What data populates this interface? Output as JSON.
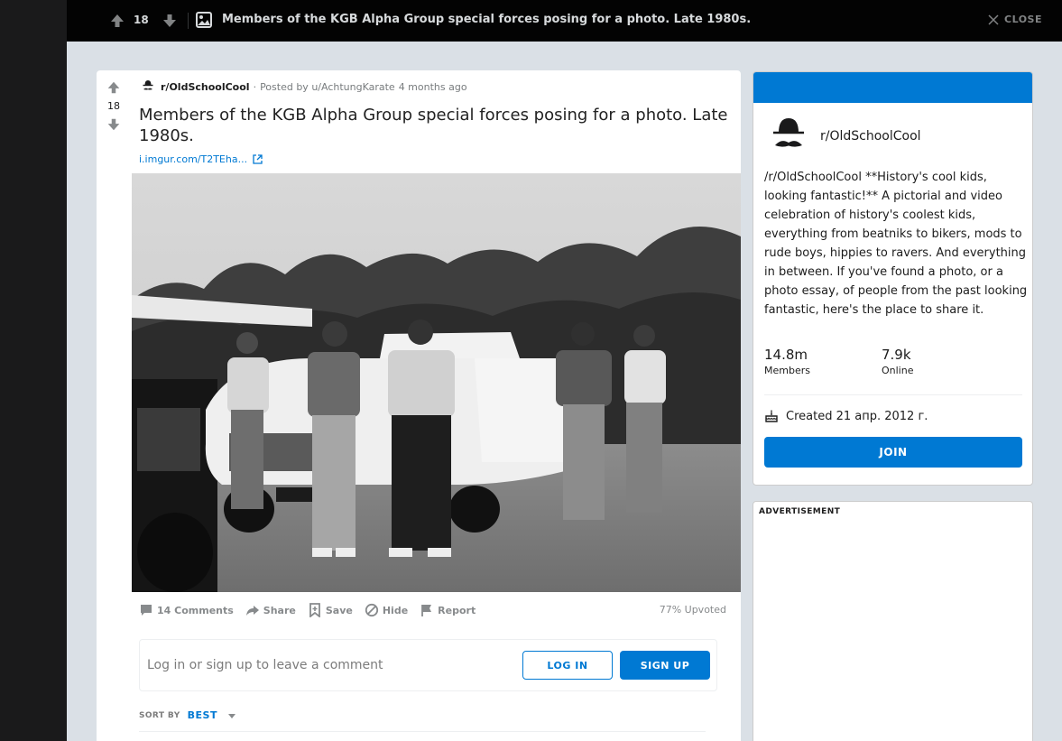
{
  "topbar": {
    "score": "18",
    "title": "Members of the KGB Alpha Group special forces posing for a photo. Late 1980s.",
    "close_label": "CLOSE"
  },
  "post": {
    "score": "18",
    "subreddit": "r/OldSchoolCool",
    "posted_by": "Posted by u/AchtungKarate",
    "time_ago": "4 months ago",
    "title": "Members of the KGB Alpha Group special forces posing for a photo. Late 1980s.",
    "link_text": "i.imgur.com/T2TEha...",
    "actions": {
      "comments": "14 Comments",
      "share": "Share",
      "save": "Save",
      "hide": "Hide",
      "report": "Report"
    },
    "upvoted": "77% Upvoted"
  },
  "comment": {
    "prompt": "Log in or sign up to leave a comment",
    "login_label": "LOG IN",
    "signup_label": "SIGN UP"
  },
  "sort": {
    "label": "SORT BY",
    "value": "BEST"
  },
  "sidebar": {
    "name": "r/OldSchoolCool",
    "description": "/r/OldSchoolCool **History's cool kids, looking fantastic!** A pictorial and video celebration of history's coolest kids, everything from beatniks to bikers, mods to rude boys, hippies to ravers. And everything in between. If you've found a photo, or a photo essay, of people from the past looking fantastic, here's the place to share it.",
    "members_count": "14.8m",
    "members_label": "Members",
    "online_count": "7.9k",
    "online_label": "Online",
    "created": "Created 21 апр. 2012 г.",
    "join_label": "JOIN"
  },
  "ad": {
    "label": "ADVERTISEMENT"
  },
  "colors": {
    "accent": "#0079d3",
    "page_bg": "#dae0e6",
    "topbar_bg": "#030303"
  },
  "icons": [
    "upvote-icon",
    "downvote-icon",
    "image-icon",
    "close-icon",
    "subreddit-icon",
    "external-link-icon",
    "comment-icon",
    "share-icon",
    "save-icon",
    "hide-icon",
    "report-icon",
    "chevron-down-icon",
    "cake-icon"
  ]
}
